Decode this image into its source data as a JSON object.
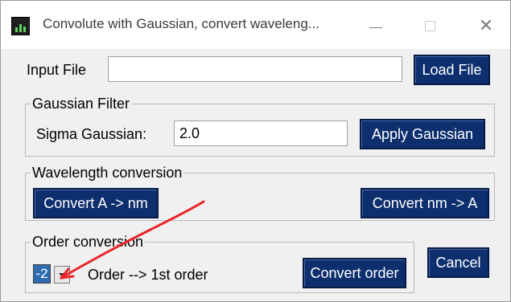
{
  "window": {
    "title": "Convolute with Gaussian, convert waveleng...",
    "minimize_icon": "minimize-icon",
    "maximize_icon": "maximize-icon",
    "close_icon": "close-icon",
    "close_glyph": "✕"
  },
  "input_file": {
    "label": "Input File",
    "value": "",
    "load_button": "Load File"
  },
  "gaussian_filter": {
    "title": "Gaussian Filter",
    "sigma_label": "Sigma Gaussian:",
    "sigma_value": "2.0",
    "apply_button": "Apply Gaussian"
  },
  "wavelength_conversion": {
    "title": "Wavelength conversion",
    "a_to_nm_button": "Convert A -> nm",
    "nm_to_a_button": "Convert nm -> A"
  },
  "order_conversion": {
    "title": "Order conversion",
    "order_value": "-2",
    "order_label": "Order --> 1st order",
    "convert_button": "Convert order"
  },
  "cancel_button": "Cancel",
  "colors": {
    "button_bg": "#0e2f6e",
    "button_text": "#ffffff",
    "annotation": "#e8262a"
  }
}
